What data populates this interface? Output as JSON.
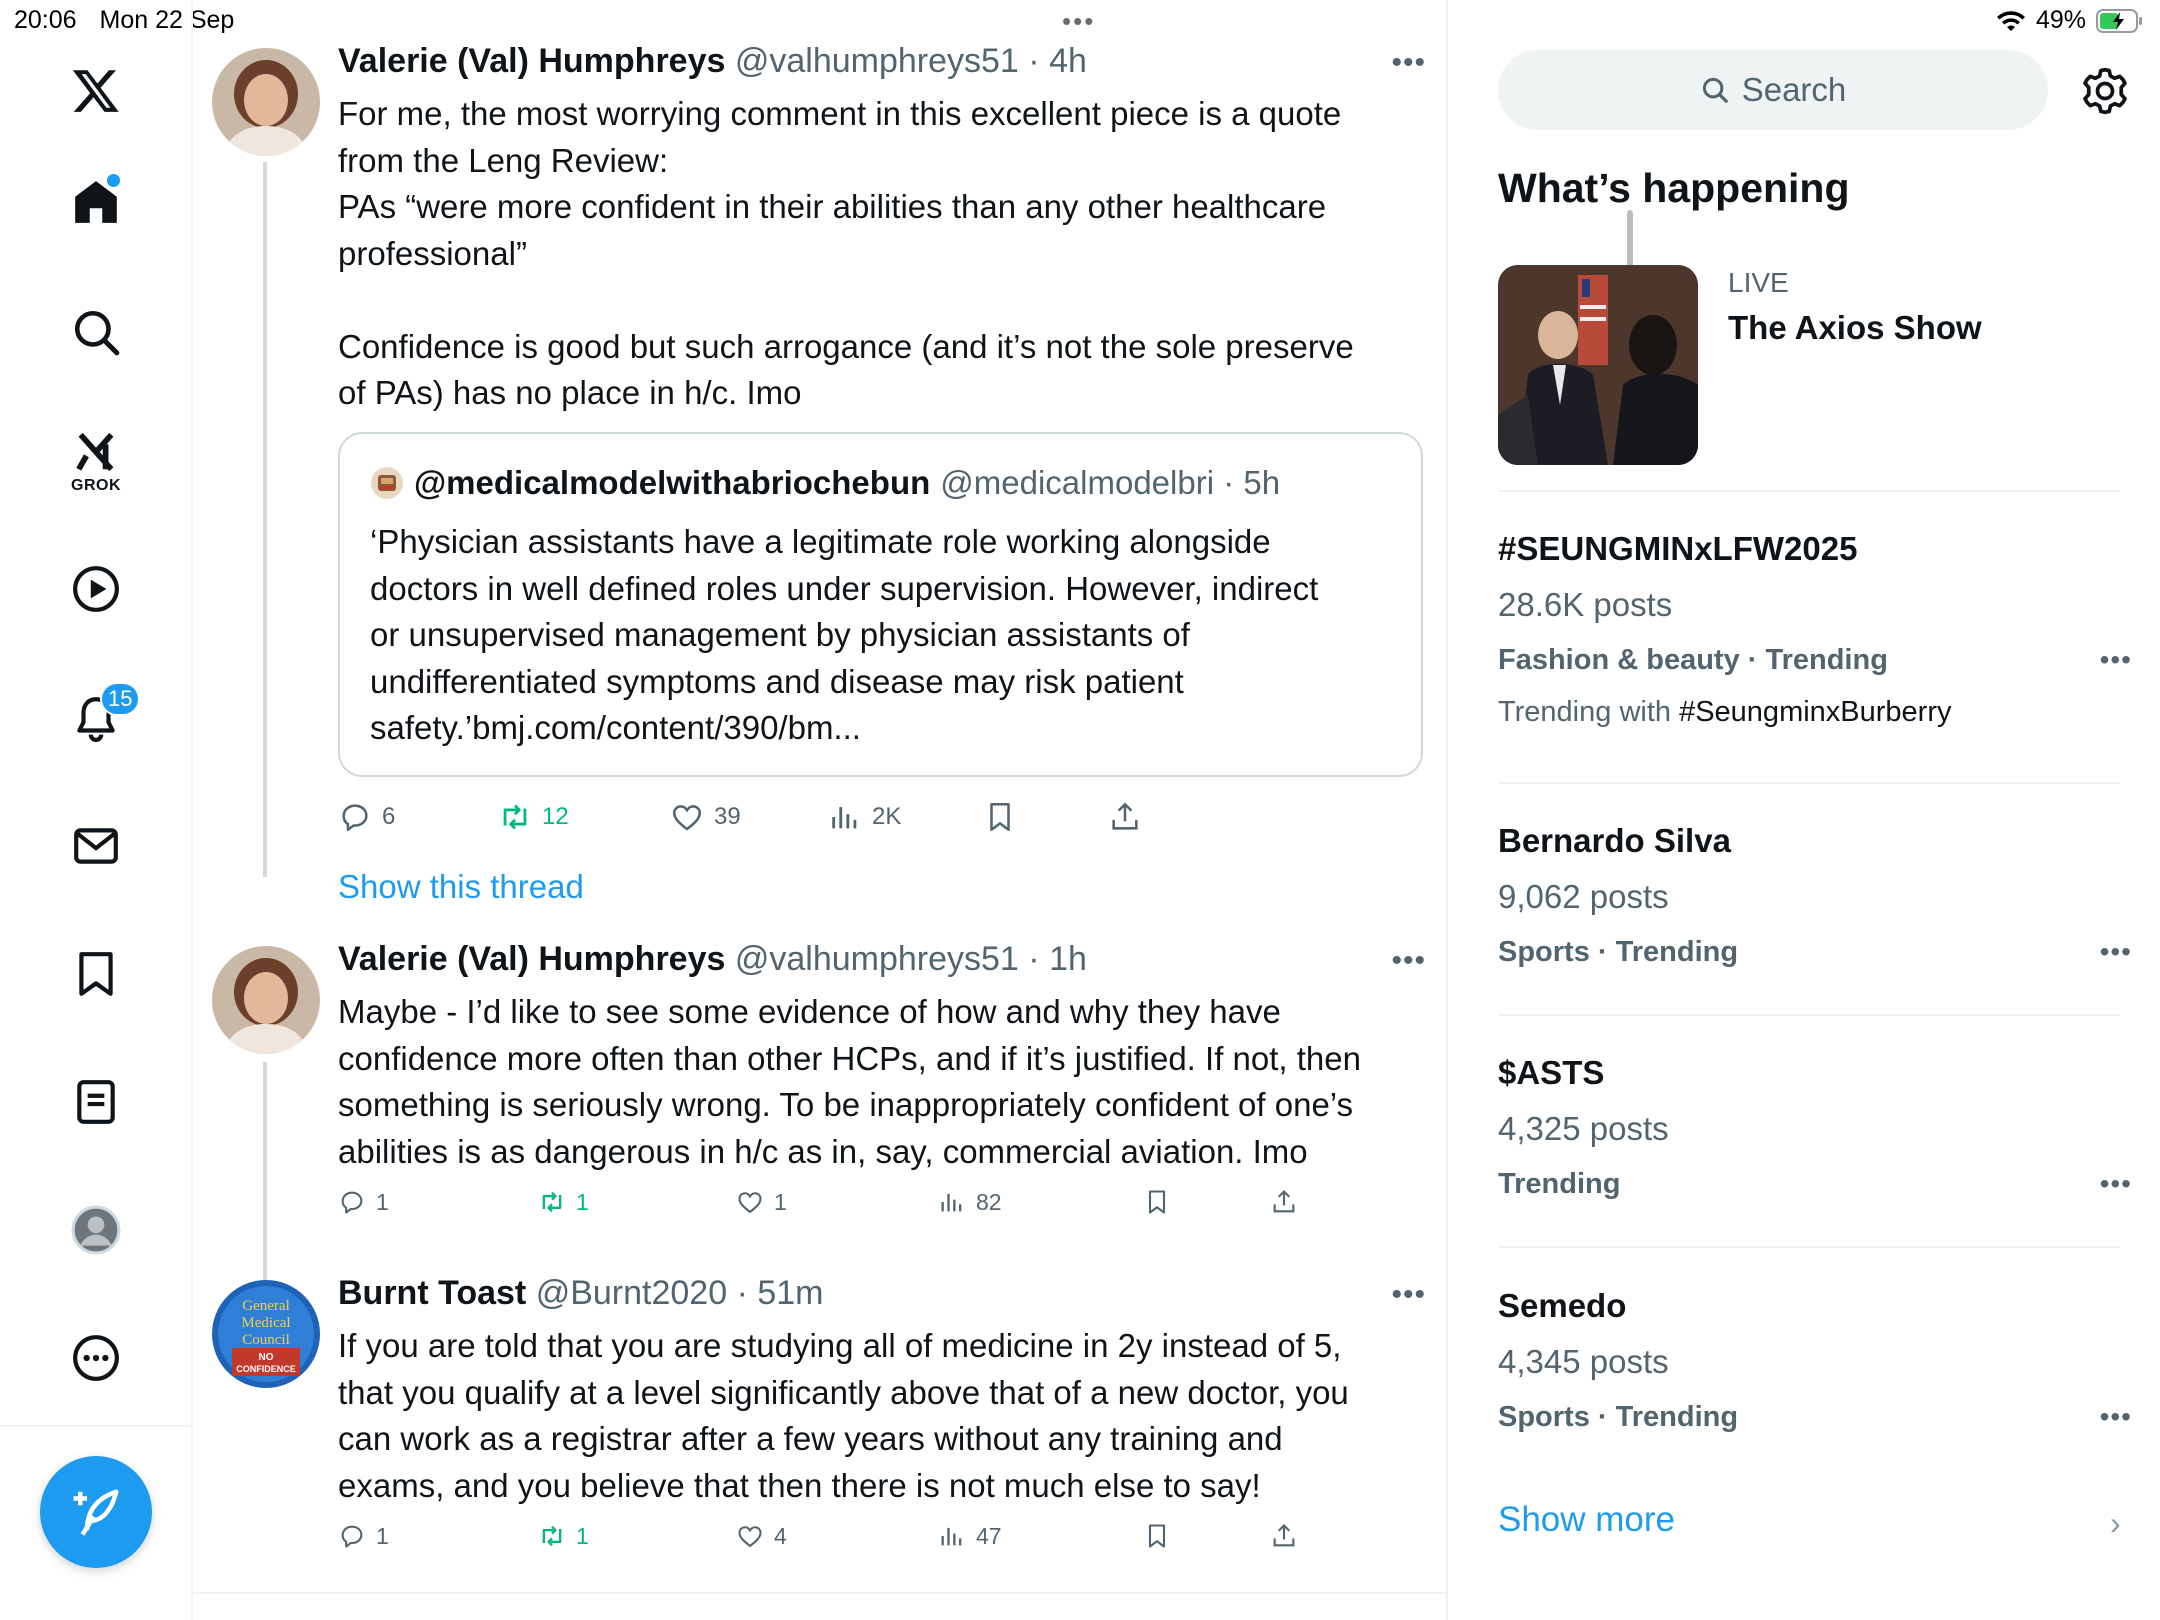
{
  "status_bar": {
    "time": "20:06",
    "date": "Mon 22 Sep",
    "battery": "49%"
  },
  "nav": {
    "badge_notifications": "15",
    "grok_label": "GROK"
  },
  "tweets": [
    {
      "name": "Valerie (Val) Humphreys",
      "handle": "@valhumphreys51",
      "time": "4h",
      "lines": [
        "For me, the most worrying comment in this excellent piece is a quote",
        "from the Leng Review:",
        "PAs “were more confident in their abilities than any other healthcare",
        "professional”",
        "",
        "Confidence is good but such arrogance (and it’s not the sole preserve",
        "of PAs) has no place in h/c. Imo"
      ],
      "quote": {
        "name": "@medicalmodelwithabriochebun",
        "handle": "@medicalmodelbri",
        "time": "5h",
        "lines": [
          "‘Physician assistants have a legitimate role working alongside",
          "doctors in well defined roles under supervision. However, indirect",
          "or unsupervised management by physician assistants of",
          "undifferentiated symptoms and disease may risk patient",
          "safety.’bmj.com/content/390/bm..."
        ]
      },
      "replies": "6",
      "reposts": "12",
      "likes": "39",
      "views": "2K",
      "show_thread": "Show this thread"
    },
    {
      "name": "Valerie (Val) Humphreys",
      "handle": "@valhumphreys51",
      "time": "1h",
      "lines": [
        "Maybe - I’d like to see some evidence of how and why they have",
        "confidence more often than other HCPs, and if it’s justified. If not, then",
        "something is seriously wrong. To be inappropriately confident of one’s",
        "abilities is as dangerous in h/c as in, say, commercial aviation. Imo"
      ],
      "replies": "1",
      "reposts": "1",
      "likes": "1",
      "views": "82"
    },
    {
      "name": "Burnt Toast",
      "handle": "@Burnt2020",
      "time": "51m",
      "avatar_text": [
        "General",
        "Medical",
        "Council",
        "NO",
        "CONFIDENCE"
      ],
      "lines": [
        "If you are told that you are studying all of medicine in 2y instead of 5,",
        "that you qualify at a level significantly above that of a new doctor, you",
        "can work as a registrar after a few years without any training and",
        "exams, and you believe that then there is not much else to say!"
      ],
      "replies": "1",
      "reposts": "1",
      "likes": "4",
      "views": "47"
    }
  ],
  "sidebar": {
    "search_placeholder": "Search",
    "section_title": "What’s happening",
    "live": {
      "label": "LIVE",
      "title": "The Axios Show"
    },
    "trends": [
      {
        "name": "#SEUNGMINxLFW2025",
        "count": "28.6K posts",
        "category": "Fashion & beauty · Trending",
        "with_prefix": "Trending with",
        "with_tag": "#SeungminxBurberry"
      },
      {
        "name": "Bernardo Silva",
        "count": "9,062 posts",
        "category": "Sports · Trending"
      },
      {
        "name": "$ASTS",
        "count": "4,325 posts",
        "category": "Trending"
      },
      {
        "name": "Semedo",
        "count": "4,345 posts",
        "category": "Sports · Trending"
      }
    ],
    "show_more": "Show more"
  },
  "icons": [
    "x-logo-icon",
    "home-icon",
    "search-icon",
    "grok-icon",
    "video-icon",
    "bell-icon",
    "mail-icon",
    "bookmark-icon",
    "lists-icon",
    "profile-icon",
    "more-icon",
    "compose-icon",
    "reply-icon",
    "repost-icon",
    "like-icon",
    "views-icon",
    "share-icon",
    "gear-icon",
    "wifi-icon",
    "battery-icon"
  ],
  "colors": {
    "accent": "#1d9bf0",
    "repost": "#00ba7c",
    "secondary_text": "#536471"
  }
}
